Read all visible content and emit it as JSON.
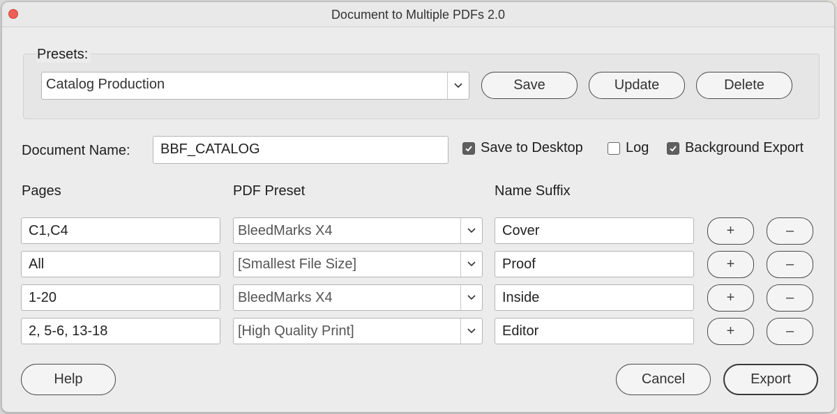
{
  "window": {
    "title": "Document to Multiple PDFs 2.0"
  },
  "presets": {
    "group_label": "Presets:",
    "selected": "Catalog Production",
    "save_label": "Save",
    "update_label": "Update",
    "delete_label": "Delete"
  },
  "document": {
    "name_label": "Document Name:",
    "name_value": "BBF_CATALOG"
  },
  "options": {
    "save_to_desktop": {
      "label": "Save to Desktop",
      "checked": true
    },
    "log": {
      "label": "Log",
      "checked": false
    },
    "background_export": {
      "label": "Background Export",
      "checked": true
    }
  },
  "columns": {
    "pages": "Pages",
    "pdf_preset": "PDF Preset",
    "name_suffix": "Name Suffix"
  },
  "rows": [
    {
      "pages": "C1,C4",
      "preset": "BleedMarks X4",
      "suffix": "Cover",
      "add": "+",
      "remove": "–"
    },
    {
      "pages": "All",
      "preset": "[Smallest File Size]",
      "suffix": "Proof",
      "add": "+",
      "remove": "–"
    },
    {
      "pages": "1-20",
      "preset": "BleedMarks X4",
      "suffix": "Inside",
      "add": "+",
      "remove": "–"
    },
    {
      "pages": "2, 5-6, 13-18",
      "preset": "[High Quality Print]",
      "suffix": "Editor",
      "add": "+",
      "remove": "–"
    }
  ],
  "footer": {
    "help_label": "Help",
    "cancel_label": "Cancel",
    "export_label": "Export"
  },
  "colors": {
    "close_button": "#ee5f56",
    "checkbox_checked": "#5f5f5f",
    "window_bg": "#ececec"
  }
}
